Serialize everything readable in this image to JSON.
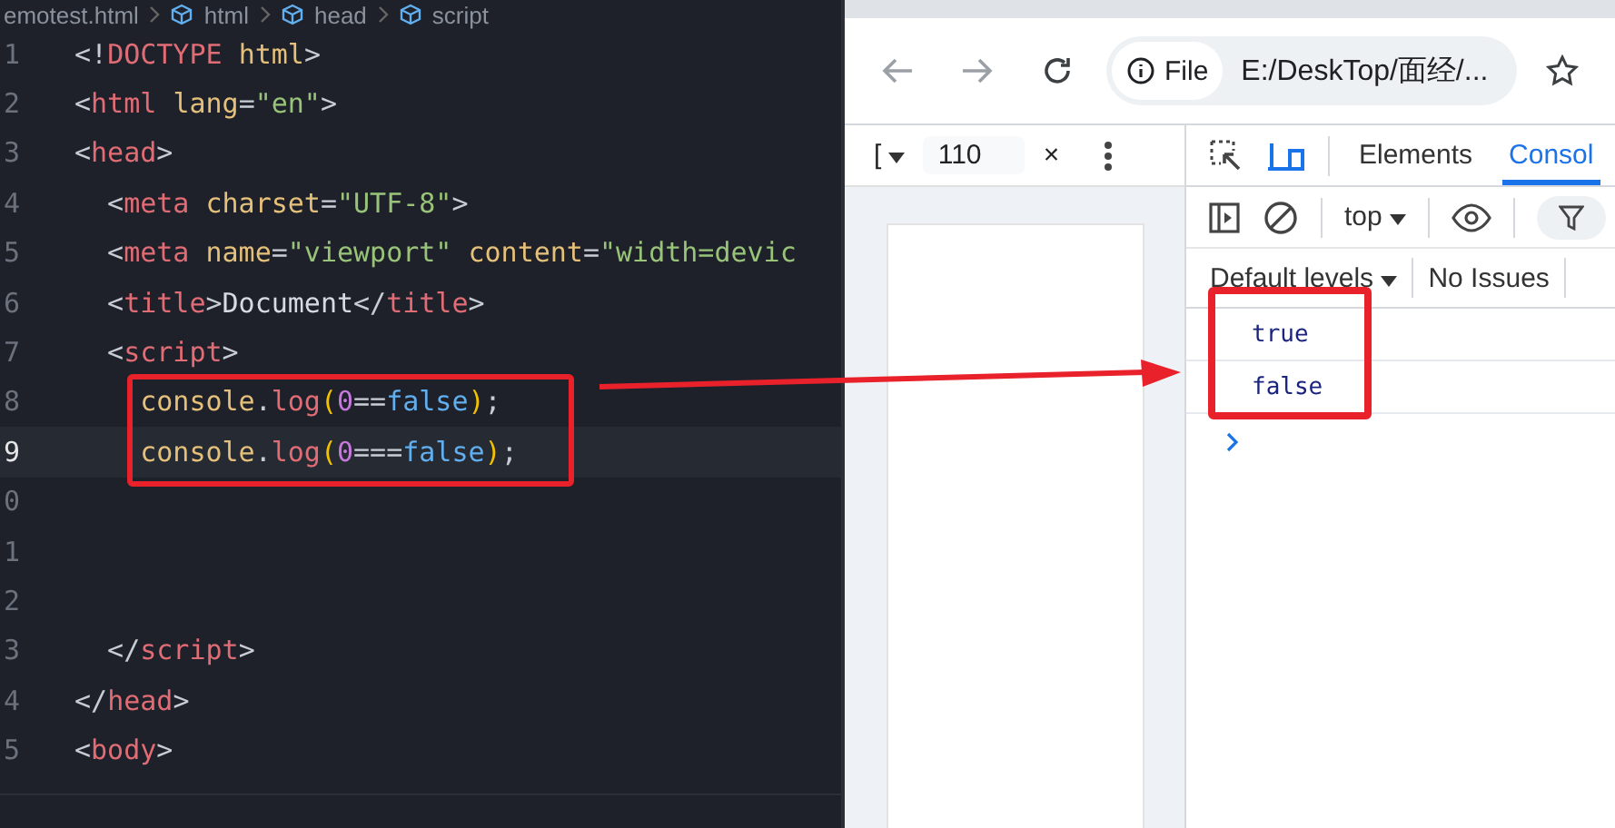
{
  "editor": {
    "breadcrumb": [
      "emotest.html",
      "html",
      "head",
      "script"
    ],
    "lines": [
      {
        "number": "1",
        "current": false,
        "tokens": [
          {
            "kind": "punct",
            "text": "<!"
          },
          {
            "kind": "tag",
            "text": "DOCTYPE "
          },
          {
            "kind": "attr",
            "text": "html"
          },
          {
            "kind": "punct",
            "text": ">"
          }
        ]
      },
      {
        "number": "2",
        "current": false,
        "tokens": [
          {
            "kind": "punct",
            "text": "<"
          },
          {
            "kind": "tag",
            "text": "html "
          },
          {
            "kind": "attr",
            "text": "lang"
          },
          {
            "kind": "punct",
            "text": "="
          },
          {
            "kind": "string",
            "text": "\"en\""
          },
          {
            "kind": "punct",
            "text": ">"
          }
        ]
      },
      {
        "number": "3",
        "current": false,
        "tokens": [
          {
            "kind": "punct",
            "text": "<"
          },
          {
            "kind": "tag",
            "text": "head"
          },
          {
            "kind": "punct",
            "text": ">"
          }
        ]
      },
      {
        "number": "4",
        "current": false,
        "tokens": [
          {
            "kind": "punct",
            "text": "  <"
          },
          {
            "kind": "tag",
            "text": "meta "
          },
          {
            "kind": "attr",
            "text": "charset"
          },
          {
            "kind": "punct",
            "text": "="
          },
          {
            "kind": "string",
            "text": "\"UTF-8\""
          },
          {
            "kind": "punct",
            "text": ">"
          }
        ]
      },
      {
        "number": "5",
        "current": false,
        "tokens": [
          {
            "kind": "punct",
            "text": "  <"
          },
          {
            "kind": "tag",
            "text": "meta "
          },
          {
            "kind": "attr",
            "text": "name"
          },
          {
            "kind": "punct",
            "text": "="
          },
          {
            "kind": "string",
            "text": "\"viewport\" "
          },
          {
            "kind": "attr",
            "text": "content"
          },
          {
            "kind": "punct",
            "text": "="
          },
          {
            "kind": "string",
            "text": "\"width=devic"
          }
        ]
      },
      {
        "number": "6",
        "current": false,
        "tokens": [
          {
            "kind": "punct",
            "text": "  <"
          },
          {
            "kind": "tag",
            "text": "title"
          },
          {
            "kind": "punct",
            "text": ">"
          },
          {
            "kind": "plain",
            "text": "Document"
          },
          {
            "kind": "punct",
            "text": "</"
          },
          {
            "kind": "tag",
            "text": "title"
          },
          {
            "kind": "punct",
            "text": ">"
          }
        ]
      },
      {
        "number": "7",
        "current": false,
        "tokens": [
          {
            "kind": "punct",
            "text": "  <"
          },
          {
            "kind": "tag",
            "text": "script"
          },
          {
            "kind": "punct",
            "text": ">"
          }
        ]
      },
      {
        "number": "8",
        "current": false,
        "tokens": [
          {
            "kind": "var",
            "text": "    console"
          },
          {
            "kind": "punct",
            "text": "."
          },
          {
            "kind": "tag",
            "text": "log"
          },
          {
            "kind": "bracket",
            "text": "("
          },
          {
            "kind": "number",
            "text": "0"
          },
          {
            "kind": "punct",
            "text": "=="
          },
          {
            "kind": "keyword",
            "text": "false"
          },
          {
            "kind": "bracket",
            "text": ")"
          },
          {
            "kind": "punct",
            "text": ";"
          }
        ]
      },
      {
        "number": "9",
        "current": true,
        "tokens": [
          {
            "kind": "var",
            "text": "    console"
          },
          {
            "kind": "punct",
            "text": "."
          },
          {
            "kind": "tag",
            "text": "log"
          },
          {
            "kind": "bracket",
            "text": "("
          },
          {
            "kind": "number",
            "text": "0"
          },
          {
            "kind": "punct",
            "text": "==="
          },
          {
            "kind": "keyword",
            "text": "false"
          },
          {
            "kind": "bracket",
            "text": ")"
          },
          {
            "kind": "punct",
            "text": ";"
          }
        ]
      },
      {
        "number": "0",
        "current": false
      },
      {
        "number": "1",
        "current": false
      },
      {
        "number": "2",
        "current": false
      },
      {
        "number": "3",
        "current": false,
        "tokens": [
          {
            "kind": "punct",
            "text": "  </"
          },
          {
            "kind": "tag",
            "text": "script"
          },
          {
            "kind": "punct",
            "text": ">"
          }
        ]
      },
      {
        "number": "4",
        "current": false,
        "tokens": [
          {
            "kind": "punct",
            "text": "</"
          },
          {
            "kind": "tag",
            "text": "head"
          },
          {
            "kind": "punct",
            "text": ">"
          }
        ]
      },
      {
        "number": "5",
        "current": false,
        "tokens": [
          {
            "kind": "punct",
            "text": "<"
          },
          {
            "kind": "tag",
            "text": "body"
          },
          {
            "kind": "punct",
            "text": ">"
          }
        ]
      }
    ]
  },
  "browser": {
    "site_chip": "File",
    "address": "E:/DeskTop/面经/...",
    "device_toolbar": {
      "dimension": "[",
      "zoom": "110",
      "separator": "×"
    },
    "devtools": {
      "tabs": [
        {
          "label": "Elements",
          "selected": false
        },
        {
          "label": "Consol",
          "selected": true
        }
      ],
      "context": "top",
      "levels": "Default levels",
      "issues": "No Issues",
      "messages": [
        "true",
        "false"
      ]
    }
  }
}
